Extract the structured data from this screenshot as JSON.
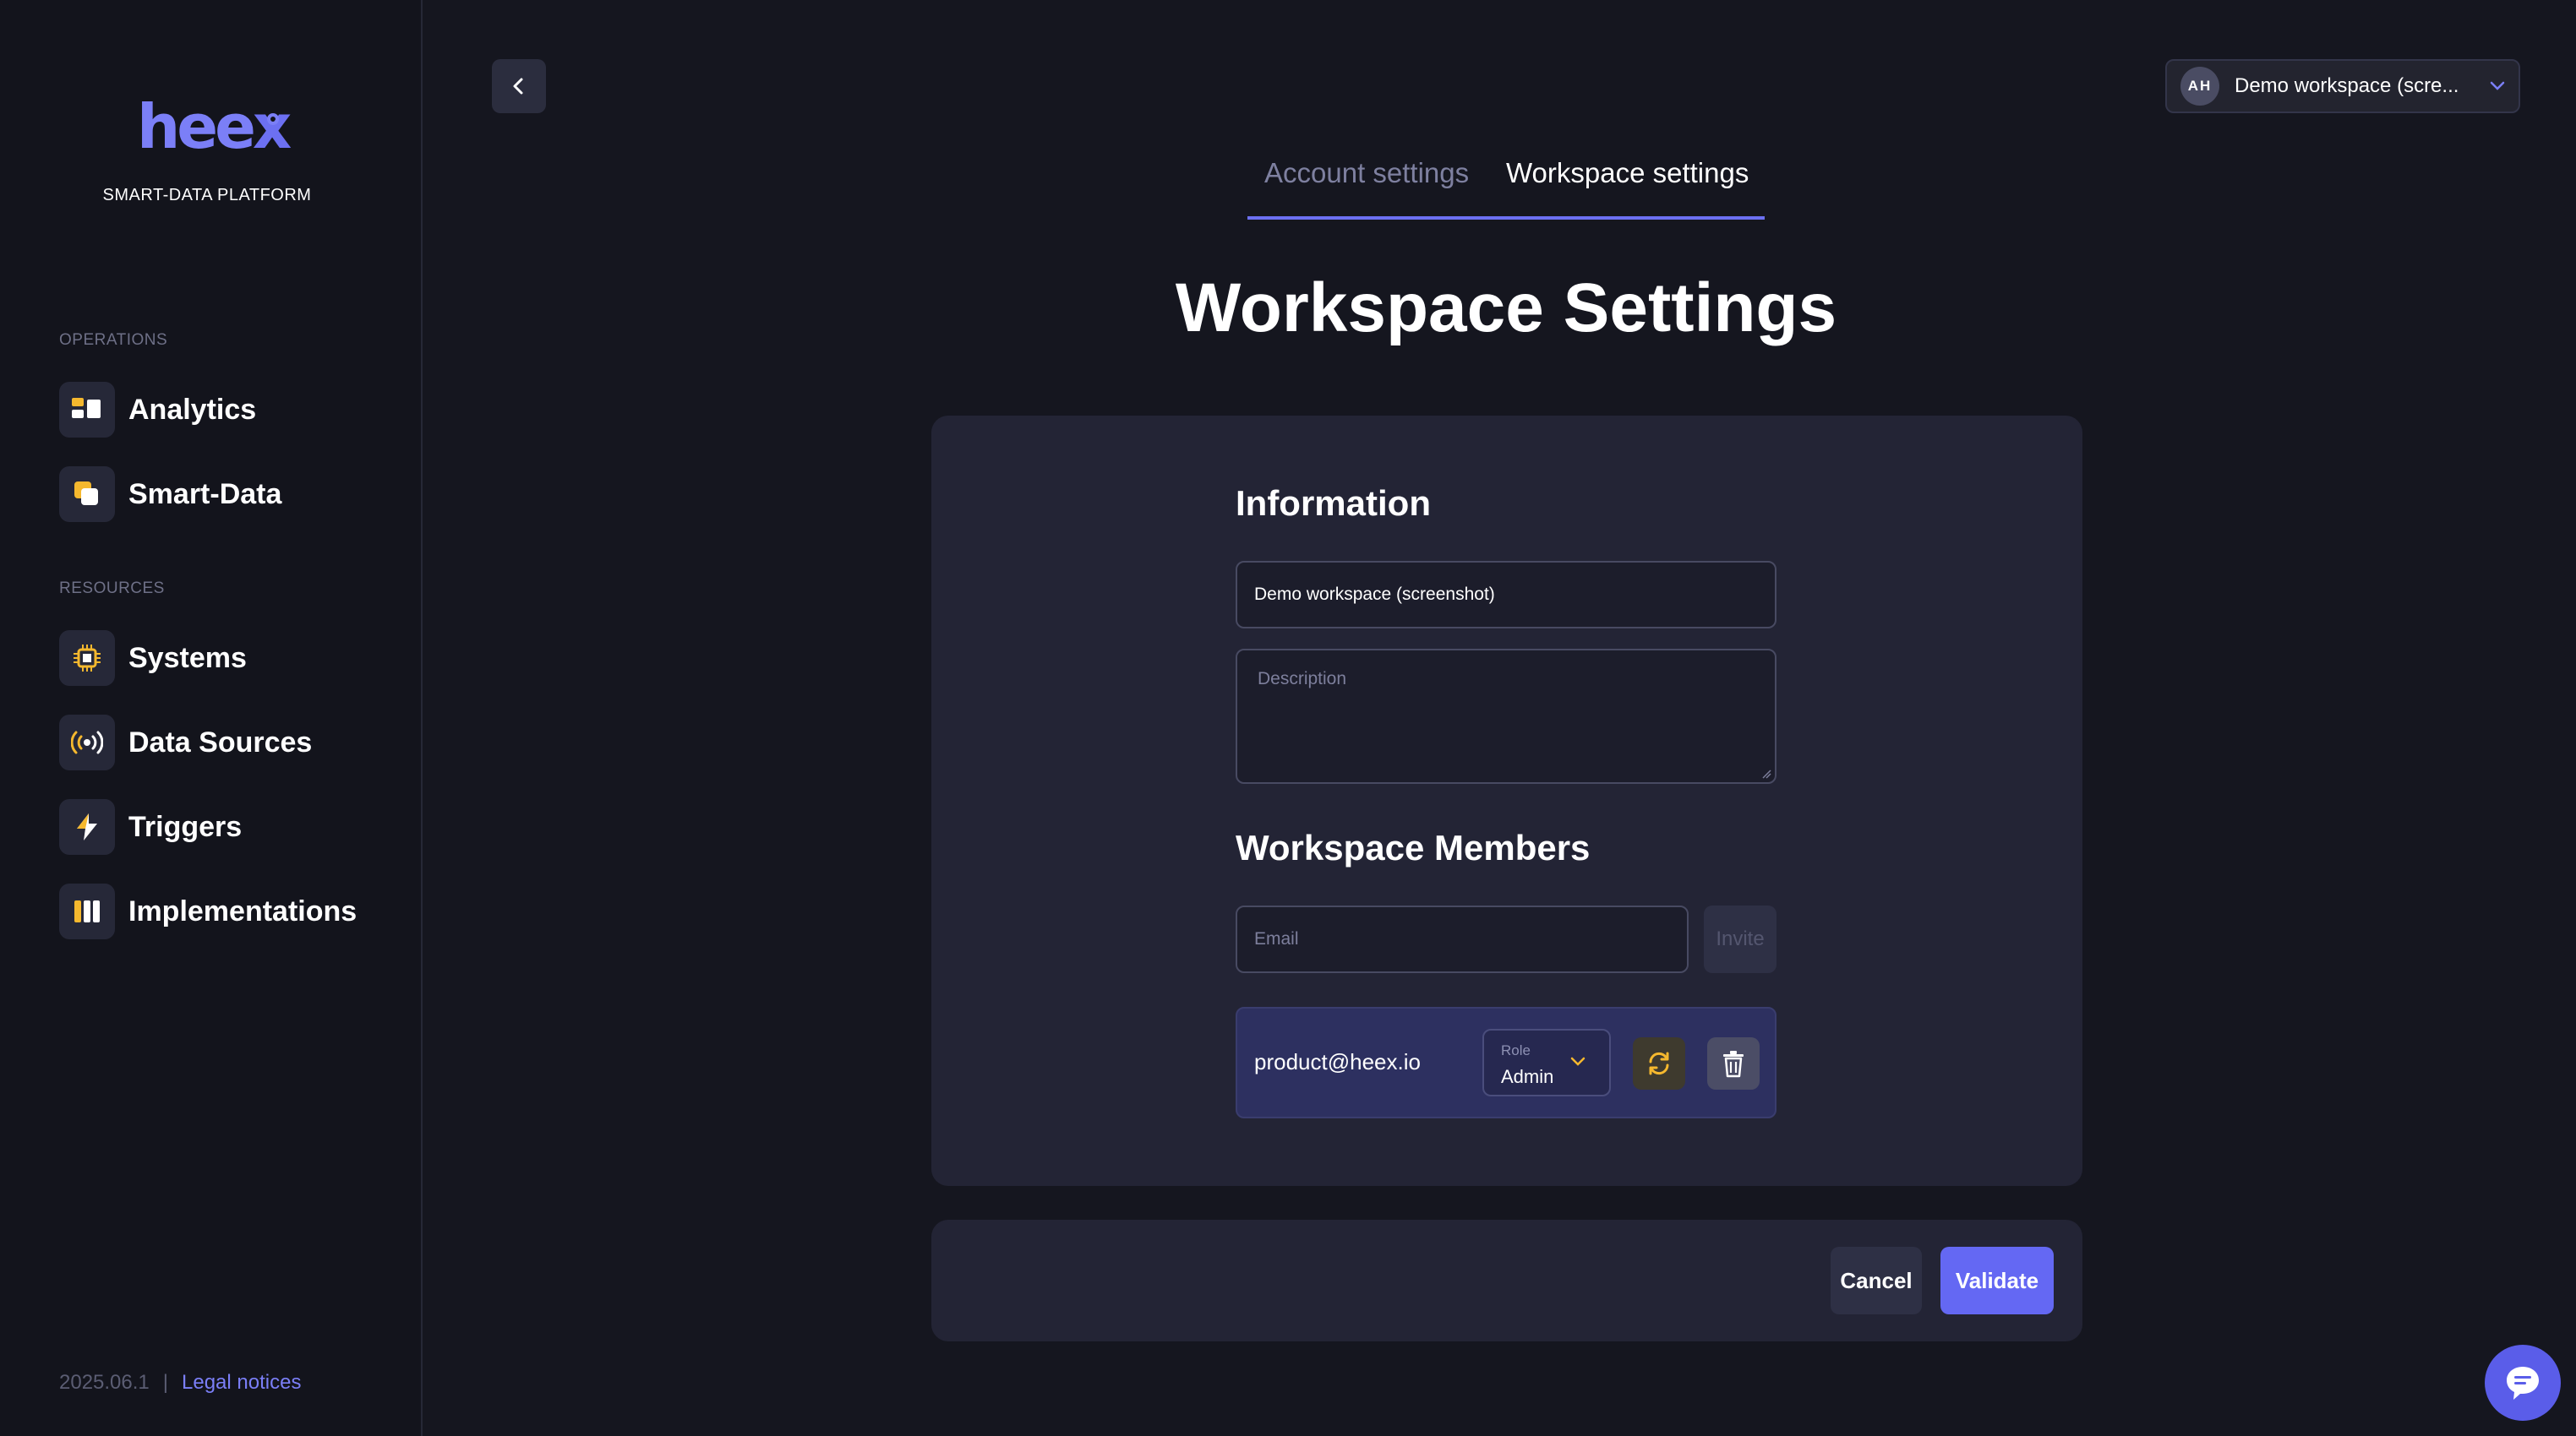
{
  "brand": {
    "logo_text": "hee",
    "logo_x": "x",
    "tagline": "SMART-DATA PLATFORM",
    "accent_color": "#6c70f2"
  },
  "sidebar": {
    "sections": [
      {
        "label": "OPERATIONS",
        "items": [
          {
            "label": "Analytics",
            "icon": "analytics-icon"
          },
          {
            "label": "Smart-Data",
            "icon": "smart-data-icon"
          }
        ]
      },
      {
        "label": "RESOURCES",
        "items": [
          {
            "label": "Systems",
            "icon": "chip-icon"
          },
          {
            "label": "Data Sources",
            "icon": "broadcast-icon"
          },
          {
            "label": "Triggers",
            "icon": "lightning-icon"
          },
          {
            "label": "Implementations",
            "icon": "columns-icon"
          }
        ]
      }
    ],
    "footer": {
      "version": "2025.06.1",
      "separator": "|",
      "legal_link": "Legal notices"
    }
  },
  "header": {
    "workspace_select": {
      "avatar_initials": "AH",
      "value": "Demo workspace (scre..."
    }
  },
  "tabs": [
    {
      "label": "Account settings",
      "active": false
    },
    {
      "label": "Workspace settings",
      "active": true
    }
  ],
  "page_title": "Workspace Settings",
  "information": {
    "title": "Information",
    "name_value": "Demo workspace (screenshot)",
    "description_placeholder": "Description"
  },
  "members": {
    "title": "Workspace Members",
    "email_placeholder": "Email",
    "invite_label": "Invite",
    "list": [
      {
        "email": "product@heex.io",
        "role_label": "Role",
        "role_value": "Admin"
      }
    ]
  },
  "actions": {
    "cancel_label": "Cancel",
    "validate_label": "Validate"
  }
}
